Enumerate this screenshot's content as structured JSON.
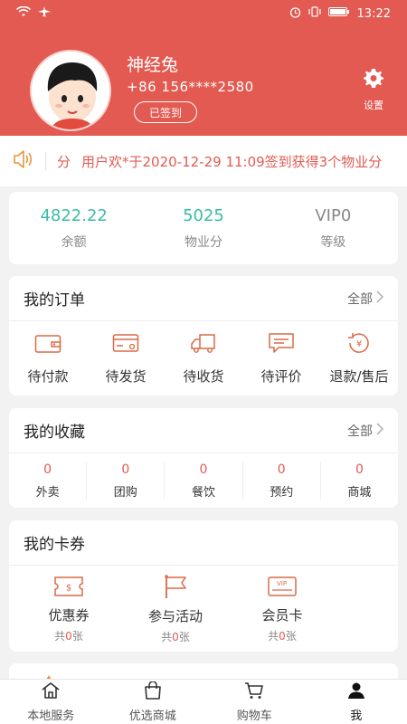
{
  "status_bar": {
    "time": "13:22"
  },
  "profile": {
    "name": "神经兔",
    "phone": "+86 156****2580",
    "signed_label": "已签到",
    "settings_label": "设置"
  },
  "notice": {
    "prefix": "分",
    "text": "用户欢*于2020-12-29 11:09签到获得3个物业分"
  },
  "stats": [
    {
      "value": "4822.22",
      "label": "余额"
    },
    {
      "value": "5025",
      "label": "物业分"
    },
    {
      "value": "VIP0",
      "label": "等级"
    }
  ],
  "orders": {
    "title": "我的订单",
    "more": "全部",
    "items": [
      {
        "label": "待付款",
        "icon": "wallet-icon"
      },
      {
        "label": "待发货",
        "icon": "card-icon"
      },
      {
        "label": "待收货",
        "icon": "truck-icon"
      },
      {
        "label": "待评价",
        "icon": "comment-icon"
      },
      {
        "label": "退款/售后",
        "icon": "refund-icon"
      }
    ]
  },
  "favorites": {
    "title": "我的收藏",
    "more": "全部",
    "items": [
      {
        "count": "0",
        "label": "外卖"
      },
      {
        "count": "0",
        "label": "团购"
      },
      {
        "count": "0",
        "label": "餐饮"
      },
      {
        "count": "0",
        "label": "预约"
      },
      {
        "count": "0",
        "label": "商城"
      }
    ]
  },
  "coupons": {
    "title": "我的卡券",
    "items": [
      {
        "label": "优惠券",
        "prefix": "共",
        "count": "0",
        "suffix": "张",
        "icon": "coupon-icon"
      },
      {
        "label": "参与活动",
        "prefix": "共",
        "count": "0",
        "suffix": "张",
        "icon": "flag-icon"
      },
      {
        "label": "会员卡",
        "prefix": "共",
        "count": "0",
        "suffix": "张",
        "icon": "vip-card-icon"
      }
    ]
  },
  "tabbar": [
    {
      "label": "本地服务",
      "icon": "home-icon"
    },
    {
      "label": "优选商城",
      "icon": "shopping-bag-icon"
    },
    {
      "label": "购物车",
      "icon": "cart-icon"
    },
    {
      "label": "我",
      "icon": "person-icon"
    }
  ],
  "colors": {
    "brand": "#e25a51",
    "accent": "#3bbca3"
  }
}
